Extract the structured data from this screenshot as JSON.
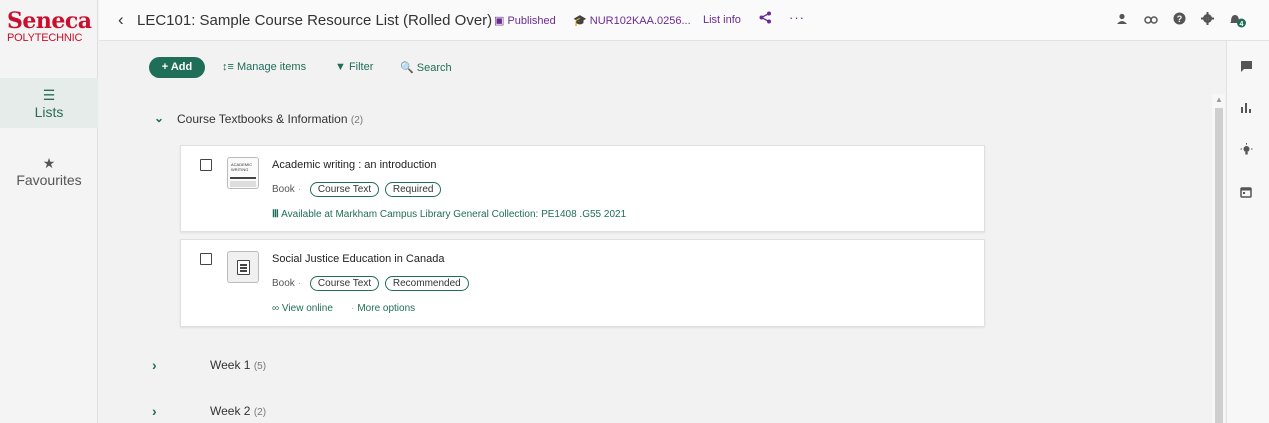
{
  "app": {
    "logo_top": "Seneca",
    "logo_bottom": "POLYTECHNIC",
    "brand_color": "#c8102e",
    "accent_color": "#1f6e57"
  },
  "sidebar": {
    "items": [
      {
        "icon": "list-icon",
        "glyph": "☰",
        "label": "Lists",
        "active": true
      },
      {
        "icon": "star-icon",
        "glyph": "★",
        "label": "Favourites",
        "active": false
      }
    ]
  },
  "header": {
    "back_glyph": "‹",
    "title": "LEC101: Sample Course Resource List (Rolled Over)",
    "published_glyph": "▣",
    "published": "Published",
    "course_glyph": "🎓",
    "course_code": "NUR102KAA.0256...",
    "list_info": "List info",
    "share_glyph": "<",
    "more_glyph": "···",
    "notification_count": "4"
  },
  "toolbar": {
    "add_label": "+ Add",
    "manage_label": "↕≡ Manage items",
    "filter_label": "▼ Filter",
    "search_label": "🔍 Search"
  },
  "sections": [
    {
      "title": "Course Textbooks & Information",
      "count": "(2)",
      "expanded": true,
      "chevron": "⌄",
      "items": [
        {
          "title": "Academic writing : an introduction",
          "type": "Book",
          "tags": [
            "Course Text",
            "Required"
          ],
          "link_icon": "library-icon",
          "link_glyph": "Ⅲ",
          "link_text": "Available at Markham Campus Library General Collection: PE1408 .G55 2021",
          "cover_text": "ACADEMIC WRITING"
        },
        {
          "title": "Social Justice Education in Canada",
          "type": "Book",
          "tags": [
            "Course Text",
            "Recommended"
          ],
          "link_icon": "link-icon",
          "link_glyph": "∞",
          "link_text": "View online",
          "link_text_2": "More options"
        }
      ]
    },
    {
      "title": "Week 1",
      "count": "(5)",
      "expanded": false,
      "chevron": "›"
    },
    {
      "title": "Week 2",
      "count": "(2)",
      "expanded": false,
      "chevron": "›"
    }
  ]
}
